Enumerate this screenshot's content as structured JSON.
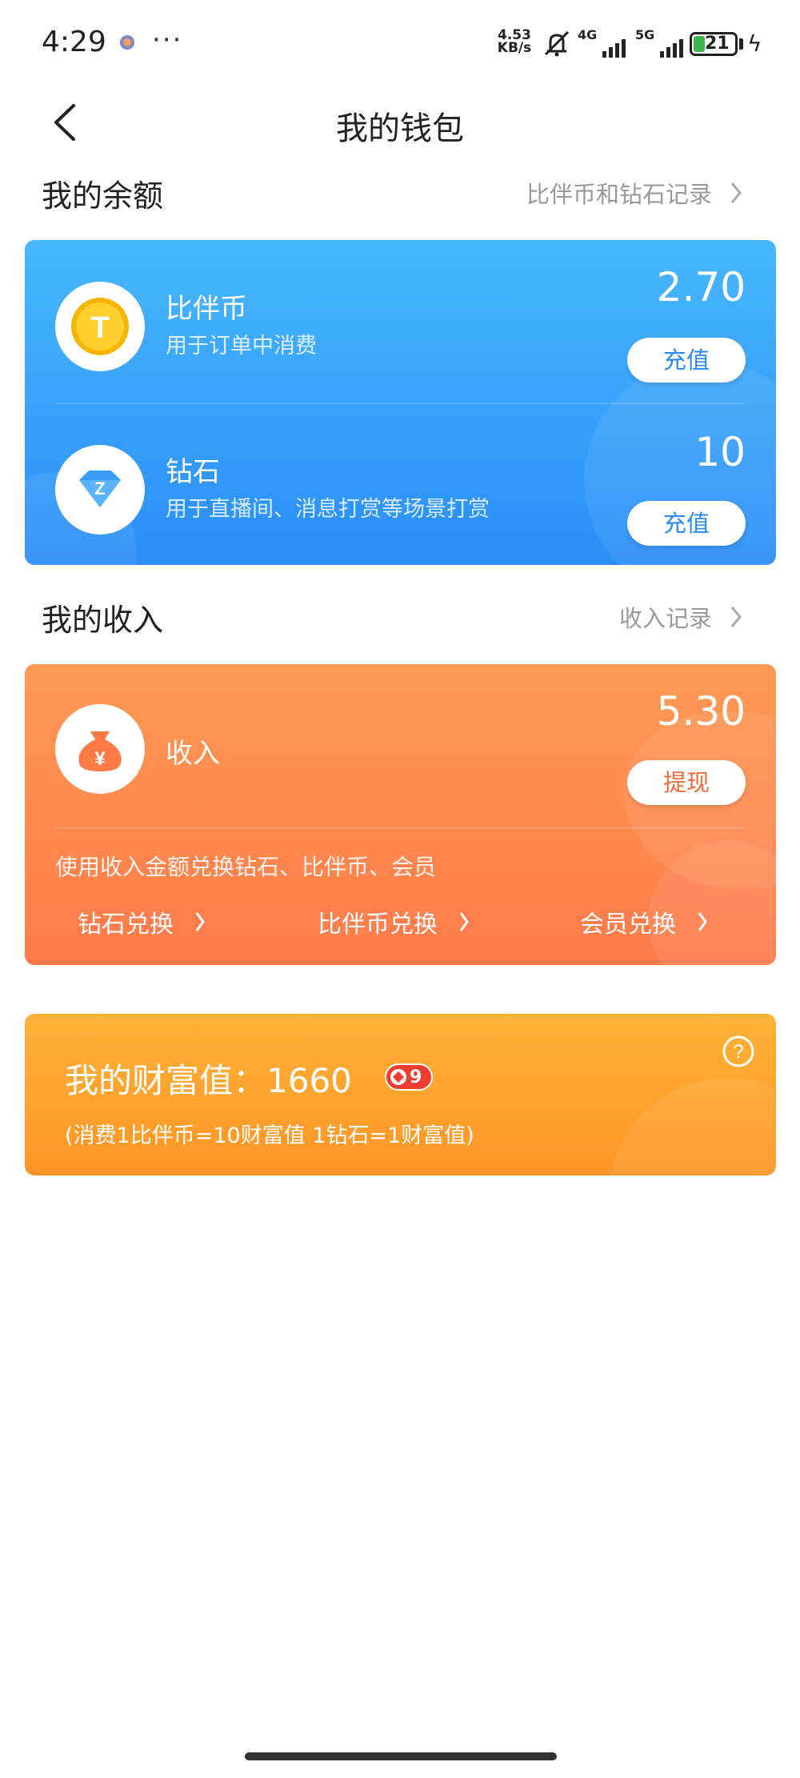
{
  "status_bar": {
    "time": "4:29",
    "more": "···",
    "net_speed_value": "4.53",
    "net_speed_unit": "KB/s",
    "net1": "4G",
    "net2": "5G",
    "battery": "21"
  },
  "nav": {
    "title": "我的钱包"
  },
  "balance": {
    "title": "我的余额",
    "record_link": "比伴币和钻石记录",
    "items": [
      {
        "name": "比伴币",
        "desc": "用于订单中消费",
        "amount": "2.70",
        "button": "充值",
        "icon": "coin-icon"
      },
      {
        "name": "钻石",
        "desc": "用于直播间、消息打赏等场景打赏",
        "amount": "10",
        "button": "充值",
        "icon": "diamond-icon"
      }
    ],
    "coin_glyph": "T",
    "diamond_glyph": "Z"
  },
  "income": {
    "title": "我的收入",
    "record_link": "收入记录",
    "name": "收入",
    "amount": "5.30",
    "button": "提现",
    "icon": "money-bag-icon",
    "money_glyph": "¥",
    "hint": "使用收入金额兑换钻石、比伴币、会员",
    "exchanges": [
      "钻石兑换",
      "比伴币兑换",
      "会员兑换"
    ]
  },
  "wealth": {
    "label": "我的财富值：1660",
    "level": "9",
    "note": "(消费1比伴币=10财富值 1钻石=1财富值)",
    "help_glyph": "?"
  },
  "colors": {
    "blue_card": "#2a8df6",
    "orange_card": "#ff7a4a",
    "gold_card": "#ff9425",
    "coin": "#f5b500"
  }
}
